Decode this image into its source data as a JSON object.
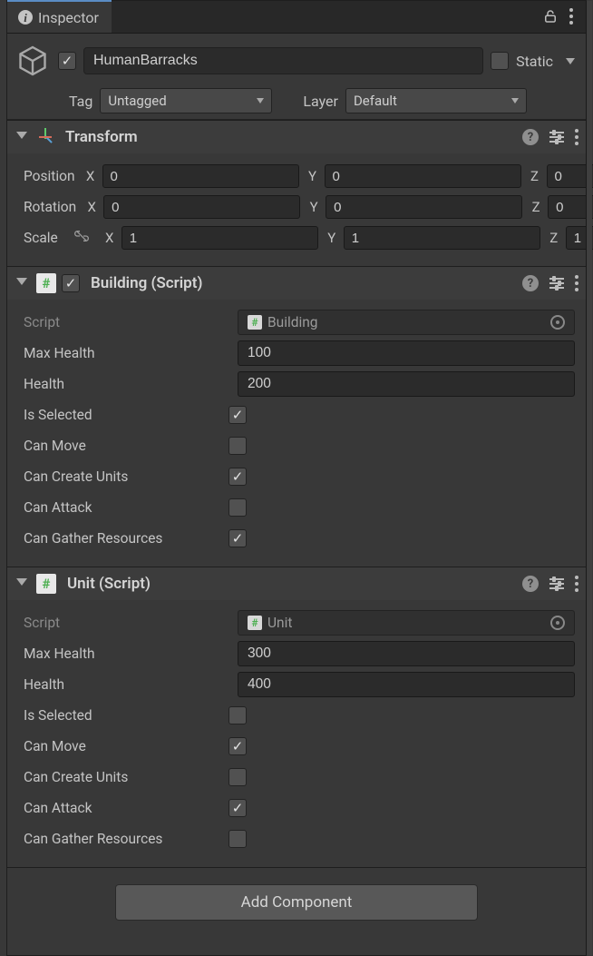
{
  "tab": {
    "label": "Inspector"
  },
  "header": {
    "enabled": true,
    "name": "HumanBarracks",
    "static_label": "Static",
    "static_checked": false,
    "tag_label": "Tag",
    "tag_value": "Untagged",
    "layer_label": "Layer",
    "layer_value": "Default"
  },
  "transform": {
    "title": "Transform",
    "position_label": "Position",
    "rotation_label": "Rotation",
    "scale_label": "Scale",
    "axis_x": "X",
    "axis_y": "Y",
    "axis_z": "Z",
    "position": {
      "x": "0",
      "y": "0",
      "z": "0"
    },
    "rotation": {
      "x": "0",
      "y": "0",
      "z": "0"
    },
    "scale": {
      "x": "1",
      "y": "1",
      "z": "1"
    }
  },
  "building": {
    "title": "Building (Script)",
    "enabled": true,
    "script_label": "Script",
    "script_value": "Building",
    "fields": {
      "max_health_label": "Max Health",
      "max_health_value": "100",
      "health_label": "Health",
      "health_value": "200",
      "is_selected_label": "Is Selected",
      "is_selected": true,
      "can_move_label": "Can Move",
      "can_move": false,
      "can_create_units_label": "Can Create Units",
      "can_create_units": true,
      "can_attack_label": "Can Attack",
      "can_attack": false,
      "can_gather_label": "Can Gather Resources",
      "can_gather": true
    }
  },
  "unit": {
    "title": "Unit (Script)",
    "script_label": "Script",
    "script_value": "Unit",
    "fields": {
      "max_health_label": "Max Health",
      "max_health_value": "300",
      "health_label": "Health",
      "health_value": "400",
      "is_selected_label": "Is Selected",
      "is_selected": false,
      "can_move_label": "Can Move",
      "can_move": true,
      "can_create_units_label": "Can Create Units",
      "can_create_units": false,
      "can_attack_label": "Can Attack",
      "can_attack": true,
      "can_gather_label": "Can Gather Resources",
      "can_gather": false
    }
  },
  "add_component_label": "Add Component"
}
